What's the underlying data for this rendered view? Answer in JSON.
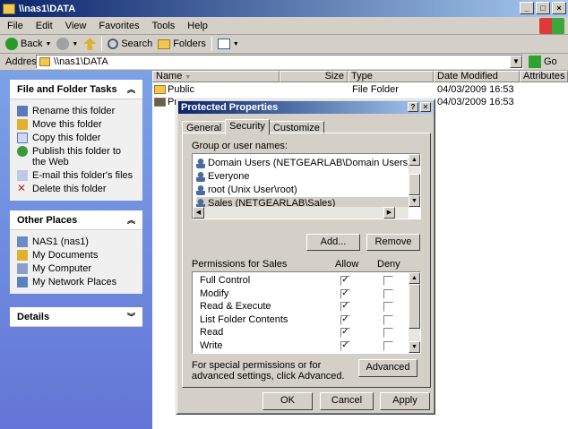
{
  "window": {
    "title": "\\\\nas1\\DATA"
  },
  "menu": [
    "File",
    "Edit",
    "View",
    "Favorites",
    "Tools",
    "Help"
  ],
  "toolbar": {
    "back": "Back",
    "search": "Search",
    "folders": "Folders"
  },
  "address": {
    "label": "Address",
    "value": "\\\\nas1\\DATA",
    "go": "Go"
  },
  "tasks": {
    "title": "File and Folder Tasks",
    "items": [
      "Rename this folder",
      "Move this folder",
      "Copy this folder",
      "Publish this folder to the Web",
      "E-mail this folder's files",
      "Delete this folder"
    ]
  },
  "places": {
    "title": "Other Places",
    "items": [
      "NAS1 (nas1)",
      "My Documents",
      "My Computer",
      "My Network Places"
    ]
  },
  "details": {
    "title": "Details"
  },
  "columns": {
    "name": "Name",
    "size": "Size",
    "type": "Type",
    "modified": "Date Modified",
    "attributes": "Attributes"
  },
  "files": [
    {
      "name": "Public",
      "type": "File Folder",
      "modified": "04/03/2009 16:53"
    },
    {
      "name": "Pr",
      "type": "",
      "modified": "04/03/2009 16:53"
    }
  ],
  "dialog": {
    "title": "Protected Properties",
    "tabs": [
      "General",
      "Security",
      "Customize"
    ],
    "groups_label": "Group or user names:",
    "users": [
      "Domain Users (NETGEARLAB\\Domain Users)",
      "Everyone",
      "root (Unix User\\root)",
      "Sales (NETGEARLAB\\Sales)"
    ],
    "add": "Add...",
    "remove": "Remove",
    "perms_label": "Permissions for Sales",
    "allow": "Allow",
    "deny": "Deny",
    "permissions": [
      {
        "name": "Full Control",
        "allow": true,
        "deny": false
      },
      {
        "name": "Modify",
        "allow": true,
        "deny": false
      },
      {
        "name": "Read & Execute",
        "allow": true,
        "deny": false
      },
      {
        "name": "List Folder Contents",
        "allow": true,
        "deny": false
      },
      {
        "name": "Read",
        "allow": true,
        "deny": false
      },
      {
        "name": "Write",
        "allow": true,
        "deny": false
      }
    ],
    "special_text": "For special permissions or for advanced settings, click Advanced.",
    "advanced": "Advanced",
    "ok": "OK",
    "cancel": "Cancel",
    "apply": "Apply"
  }
}
